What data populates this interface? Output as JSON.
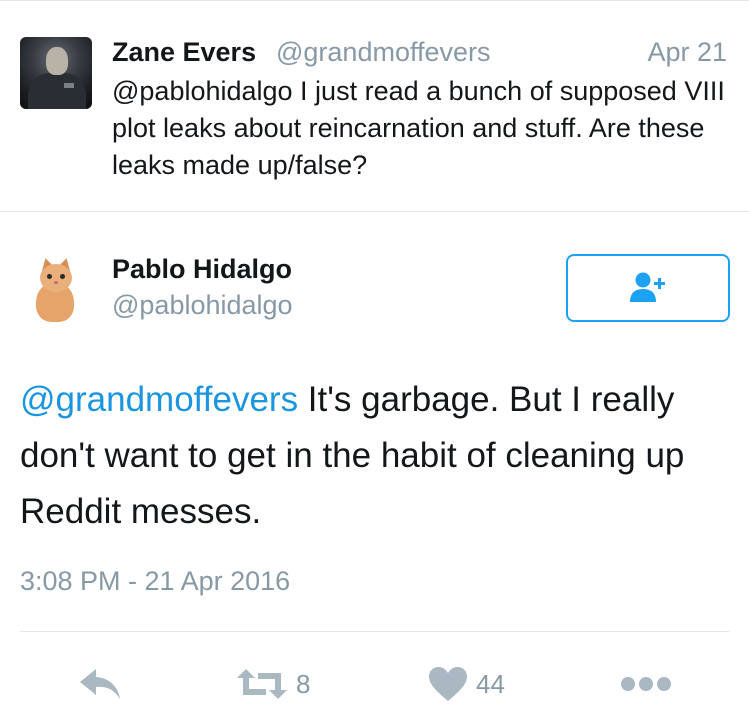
{
  "tweet_top": {
    "name": "Zane Evers",
    "handle": "@grandmoffevers",
    "date": "Apr 21",
    "text": "@pablohidalgo I just read a bunch of supposed VIII plot leaks about reincarnation and stuff. Are these leaks made up/false?"
  },
  "reply": {
    "name": "Pablo Hidalgo",
    "handle": "@pablohidalgo",
    "mention": "@grandmoffevers",
    "text": " It's garbage. But I really don't want to get in the habit of cleaning up Reddit messes.",
    "timestamp": "3:08 PM - 21 Apr 2016",
    "follow_icon": "follow-user-icon",
    "retweets": "8",
    "likes": "44"
  },
  "actions": {
    "reply_icon": "reply-icon",
    "retweet_icon": "retweet-icon",
    "like_icon": "heart-icon",
    "more_icon": "more-icon"
  },
  "colors": {
    "accent": "#1da1f2",
    "mention": "#1b95e0",
    "secondary_text": "#8899a6",
    "icon": "#aab8c2",
    "divider": "#e1e8ed"
  }
}
